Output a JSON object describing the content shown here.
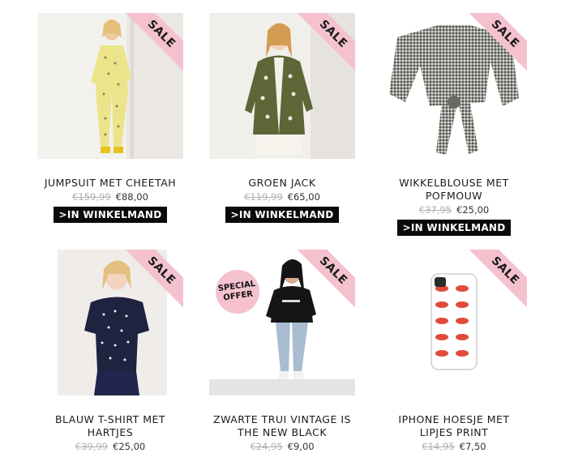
{
  "sale_label": "SALE",
  "special_offer": {
    "line1": "SPECIAL",
    "line2": "OFFER"
  },
  "cart_button_label": ">IN WINKELMAND",
  "colors": {
    "ribbon": "#f5c1cf",
    "button": "#0a0a0a"
  },
  "products": [
    {
      "title": "JUMPSUIT MET CHEETAH",
      "old_price": "€159,99",
      "new_price": "€88,00"
    },
    {
      "title": "GROEN JACK",
      "old_price": "€119,99",
      "new_price": "€65,00"
    },
    {
      "title": "WIKKELBLOUSE MET POFMOUW",
      "old_price": "€37,95",
      "new_price": "€25,00"
    },
    {
      "title": "BLAUW T-SHIRT MET HARTJES",
      "old_price": "€39,99",
      "new_price": "€25,00"
    },
    {
      "title": "ZWARTE TRUI VINTAGE IS THE NEW BLACK",
      "old_price": "€24,95",
      "new_price": "€9,00"
    },
    {
      "title": "IPHONE HOESJE MET LIPJES PRINT",
      "old_price": "€14,95",
      "new_price": "€7,50"
    }
  ]
}
